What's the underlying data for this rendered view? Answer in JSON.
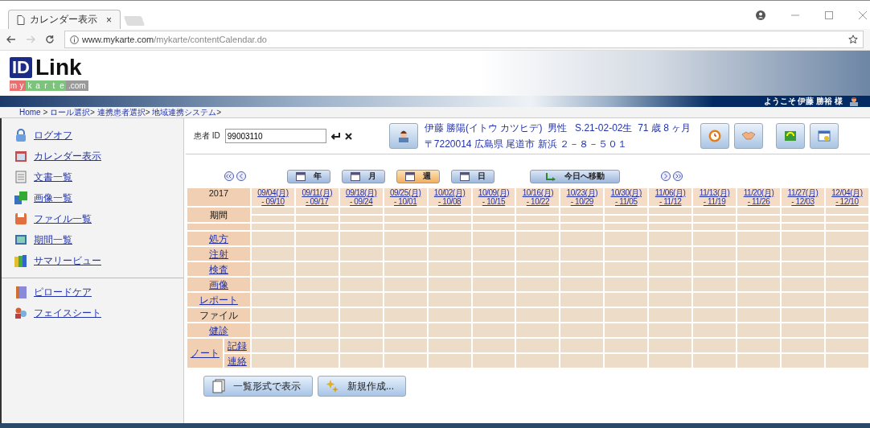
{
  "browser": {
    "tab_title": "カレンダー表示",
    "tab_close": "×",
    "url_host": "www.mykarte.com",
    "url_path": "/mykarte/contentCalendar.do"
  },
  "logo": {
    "mark": "ID",
    "name": "Link",
    "letters": [
      {
        "ch": "m",
        "color": "#e87070"
      },
      {
        "ch": "y",
        "color": "#e87070"
      },
      {
        "ch": "k",
        "color": "#7cc47c"
      },
      {
        "ch": "a",
        "color": "#7cc47c"
      },
      {
        "ch": "r",
        "color": "#7cc47c"
      },
      {
        "ch": "t",
        "color": "#7cc47c"
      },
      {
        "ch": "e",
        "color": "#7cc47c"
      }
    ],
    "domain": ".com"
  },
  "welcome": "ようこそ 伊藤 勝裕 様",
  "breadcrumb": [
    {
      "label": "Home",
      "sep": " > "
    },
    {
      "label": "ロール選択",
      "sep": "> "
    },
    {
      "label": "連携患者選択",
      "sep": "> "
    },
    {
      "label": "地域連携システム",
      "sep": ">"
    }
  ],
  "sidebar": {
    "groups": [
      [
        {
          "label": "ログオフ"
        },
        {
          "label": "カレンダー表示"
        },
        {
          "label": "文書一覧"
        },
        {
          "label": "画像一覧"
        },
        {
          "label": "ファイル一覧"
        },
        {
          "label": "期間一覧"
        },
        {
          "label": "サマリービュー"
        }
      ],
      [
        {
          "label": "ピロードケア"
        },
        {
          "label": "フェイスシート"
        }
      ]
    ]
  },
  "patient": {
    "id_label": "患者 ID",
    "id_value": "99003110",
    "name_line": "伊藤 勝陽(イトウ カツヒデ)  男性   S.21-02-02生  71 歳 8 ヶ月",
    "address_line": "〒7220014 広島県 尾道市 新浜 ２－８－５０１"
  },
  "views": [
    {
      "label": "年",
      "selected": false
    },
    {
      "label": "月",
      "selected": false
    },
    {
      "label": "週",
      "selected": true
    },
    {
      "label": "日",
      "selected": false
    }
  ],
  "today_button": "今日へ移動",
  "calendar": {
    "year": "2017",
    "weeks": [
      {
        "start": "09/04(月)",
        "end": "- 09/10"
      },
      {
        "start": "09/11(月)",
        "end": "- 09/17"
      },
      {
        "start": "09/18(月)",
        "end": "- 09/24"
      },
      {
        "start": "09/25(月)",
        "end": "- 10/01"
      },
      {
        "start": "10/02(月)",
        "end": "- 10/08"
      },
      {
        "start": "10/09(月)",
        "end": "- 10/15"
      },
      {
        "start": "10/16(月)",
        "end": "- 10/22"
      },
      {
        "start": "10/23(月)",
        "end": "- 10/29"
      },
      {
        "start": "10/30(月)",
        "end": "- 11/05"
      },
      {
        "start": "11/06(月)",
        "end": "- 11/12"
      },
      {
        "start": "11/13(月)",
        "end": "- 11/19"
      },
      {
        "start": "11/20(月)",
        "end": "- 11/26"
      },
      {
        "start": "11/27(月)",
        "end": "- 12/03"
      },
      {
        "start": "12/04(月)",
        "end": "- 12/10"
      }
    ],
    "rows": [
      {
        "kind": "period",
        "label": "期間"
      },
      {
        "kind": "blank"
      },
      {
        "kind": "link",
        "label": "処方"
      },
      {
        "kind": "link",
        "label": "注射"
      },
      {
        "kind": "link",
        "label": "検査"
      },
      {
        "kind": "link",
        "label": "画像"
      },
      {
        "kind": "link",
        "label": "レポート"
      },
      {
        "kind": "text",
        "label": "ファイル"
      },
      {
        "kind": "link",
        "label": "健診"
      },
      {
        "kind": "group",
        "label": "ノート",
        "children": [
          {
            "label": "記録"
          },
          {
            "label": "連絡"
          }
        ]
      }
    ]
  },
  "bottom_buttons": [
    "一覧形式で表示",
    "新規作成..."
  ]
}
